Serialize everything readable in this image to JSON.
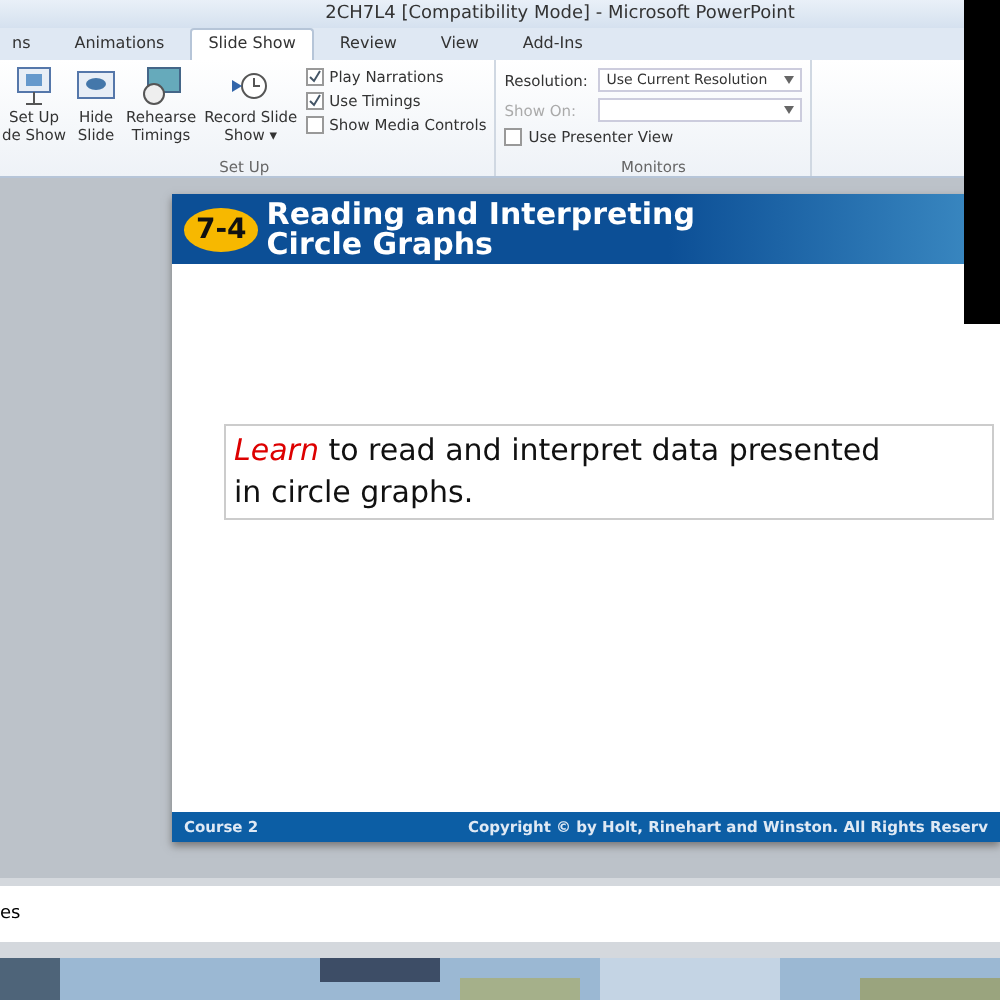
{
  "window": {
    "title": "2CH7L4 [Compatibility Mode] - Microsoft PowerPoint"
  },
  "tabs": [
    {
      "label": "ns",
      "selected": false
    },
    {
      "label": "Animations",
      "selected": false
    },
    {
      "label": "Slide Show",
      "selected": true
    },
    {
      "label": "Review",
      "selected": false
    },
    {
      "label": "View",
      "selected": false
    },
    {
      "label": "Add-Ins",
      "selected": false
    }
  ],
  "ribbon": {
    "setup": {
      "label": "Set Up",
      "buttons": [
        {
          "kind": "setup",
          "lines": [
            "Set Up",
            "de Show"
          ]
        },
        {
          "kind": "hide",
          "lines": [
            "Hide",
            "Slide"
          ]
        },
        {
          "kind": "rehearse",
          "lines": [
            "Rehearse",
            "Timings"
          ]
        },
        {
          "kind": "record",
          "lines": [
            "Record Slide",
            "Show ▾"
          ]
        }
      ],
      "checks": [
        {
          "label": "Play Narrations",
          "checked": true
        },
        {
          "label": "Use Timings",
          "checked": true
        },
        {
          "label": "Show Media Controls",
          "checked": false
        }
      ]
    },
    "monitors": {
      "label": "Monitors",
      "resolution": {
        "label": "Resolution:",
        "value": "Use Current Resolution",
        "disabled": false
      },
      "show_on": {
        "label": "Show On:",
        "disabled": true
      },
      "presenter": {
        "label": "Use Presenter View",
        "checked": false
      }
    }
  },
  "slide": {
    "badge": "7-4",
    "title": [
      "Reading and Interpreting",
      "Circle Graphs"
    ],
    "objective": {
      "highlight": "Learn",
      "text": " to read and interpret data presented in circle graphs."
    },
    "footer_left": "Course 2",
    "footer_right": "Copyright © by Holt, Rinehart and Winston. All Rights Reserv"
  },
  "notes": {
    "text": "es"
  }
}
